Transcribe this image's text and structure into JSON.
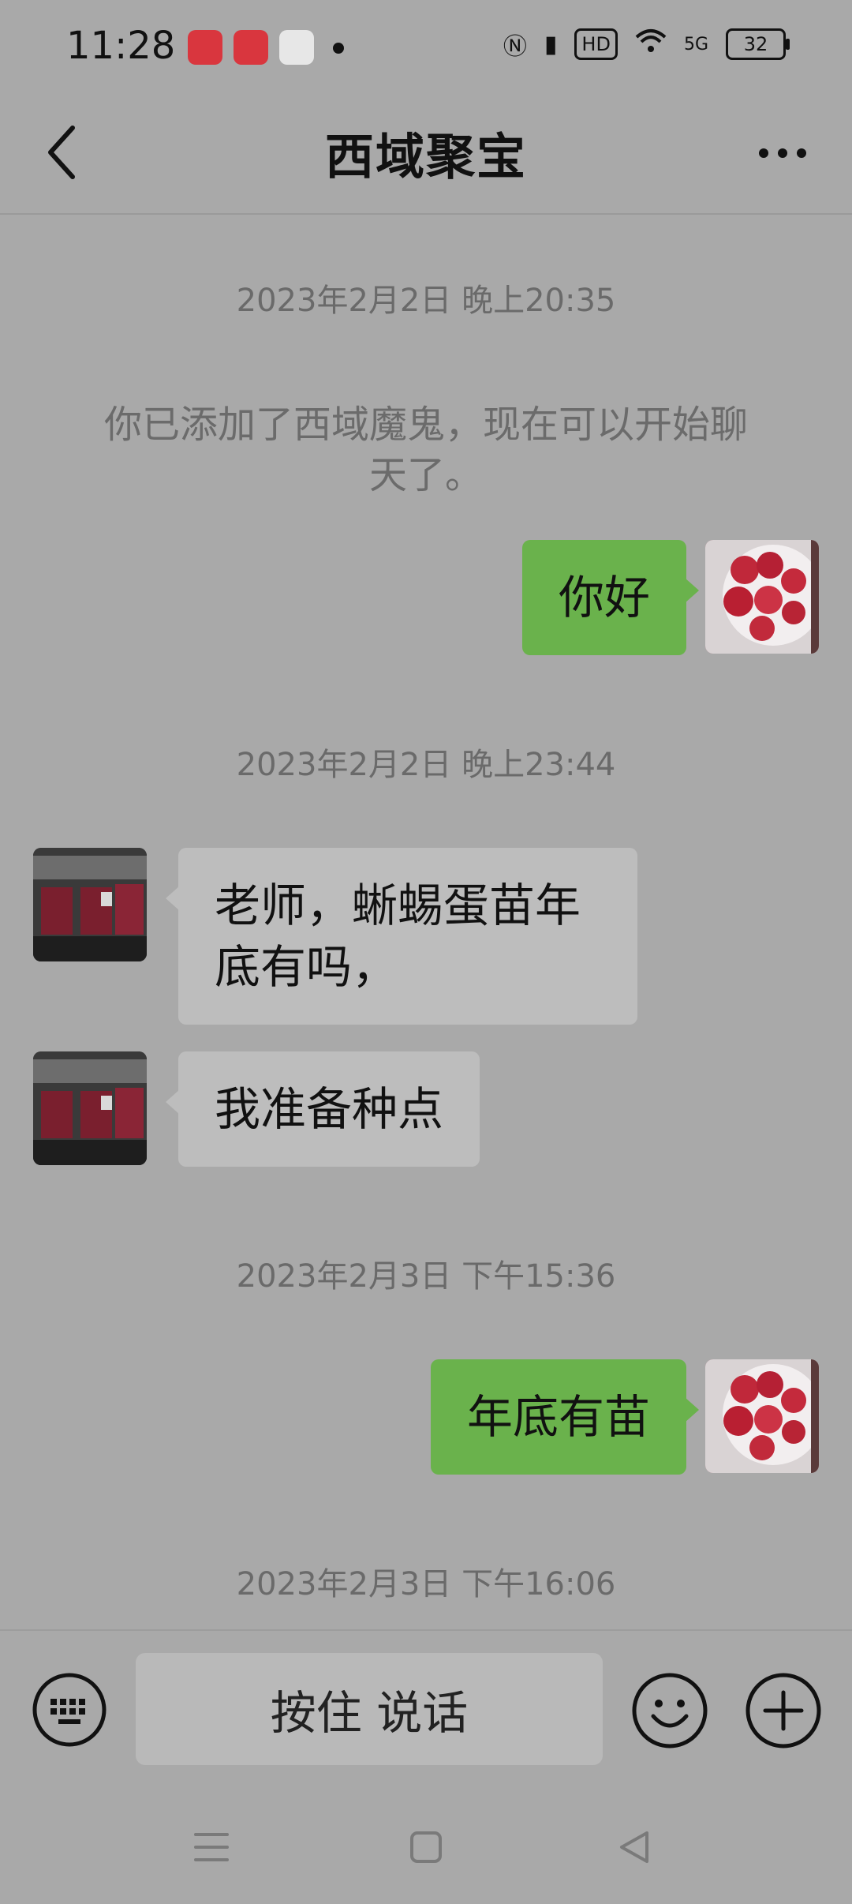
{
  "status_bar": {
    "time": "11:28",
    "network": "5G",
    "battery": "32",
    "hd_label": "HD"
  },
  "header": {
    "title": "西域聚宝"
  },
  "messages": {
    "ts1": "2023年2月2日 晚上20:35",
    "system": "你已添加了西域魔鬼，现在可以开始聊天了。",
    "m1": "你好",
    "ts2": "2023年2月2日 晚上23:44",
    "m2": "老师，蜥蜴蛋苗年底有吗，",
    "m3": "我准备种点",
    "ts3": "2023年2月3日 下午15:36",
    "m4": "年底有苗",
    "ts4": "2023年2月3日 下午16:06"
  },
  "input_bar": {
    "voice_label": "按住 说话"
  },
  "icons": {
    "back": "chevron-left-icon",
    "more": "more-icon",
    "keyboard": "keyboard-icon",
    "emoji": "emoji-icon",
    "plus": "plus-icon",
    "menu": "menu-icon",
    "home": "home-icon",
    "back_nav": "back-triangle-icon"
  },
  "colors": {
    "my_bubble": "#6ab24c",
    "other_bubble": "#bdbdbd",
    "background": "#a9a9a9"
  }
}
